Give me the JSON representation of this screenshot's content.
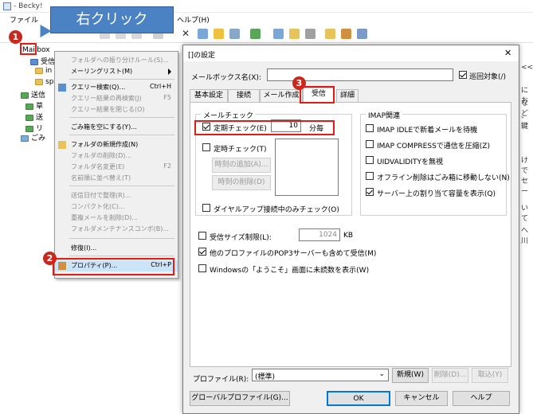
{
  "window": {
    "title": "- Becky!"
  },
  "menubar": {
    "items": [
      "ファイル",
      "ヘルプ(H)"
    ]
  },
  "callout": {
    "text": "右クリック"
  },
  "steps": {
    "one": "1",
    "two": "2",
    "three": "3"
  },
  "tree": {
    "root": "Mailbox",
    "items": [
      "受信",
      "in",
      "sp",
      "送信",
      "草",
      "送",
      "リ",
      "ごみ"
    ]
  },
  "context_menu": {
    "items": [
      {
        "label": "フォルダへの振り分けルール(S)...",
        "shortcut": "",
        "disabled": true
      },
      {
        "label": "メーリングリスト(M)",
        "shortcut": "",
        "disabled": false,
        "submenu": true
      },
      {
        "label": "クエリー検索(Q)...",
        "shortcut": "Ctrl+H",
        "disabled": false
      },
      {
        "label": "クエリー結果の再検索(J)",
        "shortcut": "F5",
        "disabled": true
      },
      {
        "label": "クエリー結果を閉じる(O)",
        "shortcut": "",
        "disabled": true
      },
      {
        "label": "ごみ箱を空にする(Y)...",
        "shortcut": "",
        "disabled": false
      },
      {
        "label": "フォルダの新規作成(N)",
        "shortcut": "",
        "disabled": false
      },
      {
        "label": "フォルダの削除(D)...",
        "shortcut": "",
        "disabled": true
      },
      {
        "label": "フォルダ名変更(E)",
        "shortcut": "F2",
        "disabled": true
      },
      {
        "label": "名前順に並べ替え(T)",
        "shortcut": "",
        "disabled": true
      },
      {
        "label": "送信日付で整理(R)...",
        "shortcut": "",
        "disabled": true
      },
      {
        "label": "コンパクト化(C)...",
        "shortcut": "",
        "disabled": true
      },
      {
        "label": "重複メールを削除(D)...",
        "shortcut": "",
        "disabled": true
      },
      {
        "label": "フォルダメンテナンスコンボ(B)...",
        "shortcut": "",
        "disabled": true
      },
      {
        "label": "修復(I)...",
        "shortcut": "",
        "disabled": false
      },
      {
        "label": "プロパティ(P)...",
        "shortcut": "Ctrl+P",
        "disabled": false
      }
    ]
  },
  "dialog": {
    "title": "[]の設定",
    "close_glyph": "✕",
    "mailbox_name_label": "メールボックス名(X):",
    "mailbox_name_value": "",
    "patrol_label": "巡回対象(/)",
    "patrol_checked": true,
    "tabs": [
      "基本設定",
      "接続",
      "メール作成",
      "受信",
      "詳細"
    ],
    "active_tab": "受信",
    "mail_check": {
      "group_title": "メールチェック",
      "periodic_label": "定期チェック(E)",
      "periodic_checked": true,
      "periodic_value": "10",
      "periodic_unit": "分毎",
      "timed_label": "定時チェック(T)",
      "timed_checked": false,
      "add_time": "時刻の追加(A)...",
      "del_time": "時刻の削除(D)",
      "dialup_label": "ダイヤルアップ接続中のみチェック(O)",
      "dialup_checked": false
    },
    "imap": {
      "group_title": "IMAP関連",
      "options": [
        {
          "label": "IMAP IDLEで新着メールを待機",
          "checked": false
        },
        {
          "label": "IMAP COMPRESSで通信を圧縮(Z)",
          "checked": false
        },
        {
          "label": "UIDVALIDITYを無視",
          "checked": false
        },
        {
          "label": "オフライン削除はごみ箱に移動しない(N)",
          "checked": false
        },
        {
          "label": "サーバー上の割り当て容量を表示(Q)",
          "checked": true
        }
      ]
    },
    "size_limit_label": "受信サイズ制限(L):",
    "size_limit_checked": false,
    "size_limit_value": "1024",
    "size_limit_unit": "KB",
    "pop3_label": "他のプロファイルのPOP3サーバーも含めて受信(M)",
    "pop3_checked": true,
    "welcome_label": "Windowsの「ようこそ」画面に未読数を表示(W)",
    "welcome_checked": false,
    "profile_label": "プロファイル(R):",
    "profile_value": "(標準)",
    "new_btn": "新規(W)",
    "delete_btn": "削除(D)...",
    "copy_btn": "取込(Y)",
    "global_btn": "グローバルプロファイル(G)...",
    "ok_btn": "OK",
    "cancel_btn": "キャンセル",
    "help_btn": "ヘルプ"
  },
  "right_strip": [
    "<<",
    "にお",
    "など",
    "、鍵",
    "けで",
    "セー",
    "いて",
    "へ川"
  ]
}
